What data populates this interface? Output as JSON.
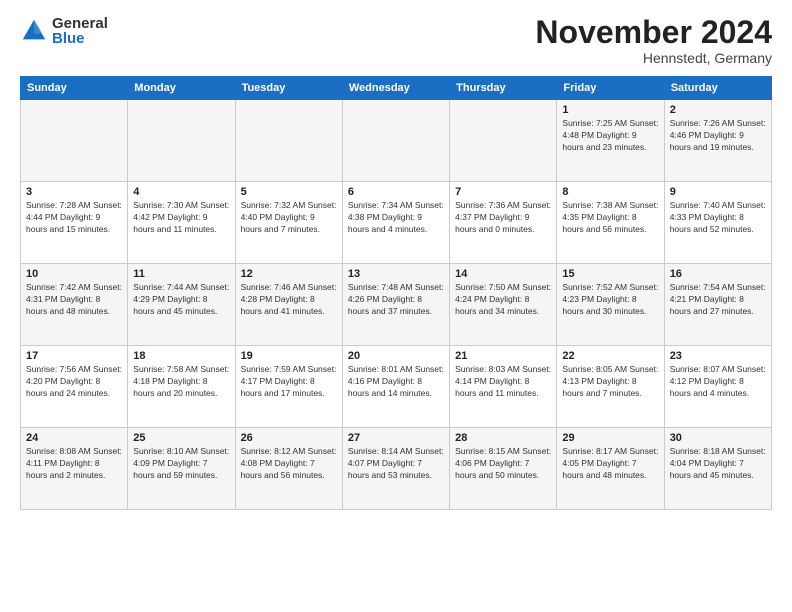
{
  "header": {
    "logo_general": "General",
    "logo_blue": "Blue",
    "month_title": "November 2024",
    "location": "Hennstedt, Germany"
  },
  "weekdays": [
    "Sunday",
    "Monday",
    "Tuesday",
    "Wednesday",
    "Thursday",
    "Friday",
    "Saturday"
  ],
  "weeks": [
    [
      {
        "day": "",
        "info": ""
      },
      {
        "day": "",
        "info": ""
      },
      {
        "day": "",
        "info": ""
      },
      {
        "day": "",
        "info": ""
      },
      {
        "day": "",
        "info": ""
      },
      {
        "day": "1",
        "info": "Sunrise: 7:25 AM\nSunset: 4:48 PM\nDaylight: 9 hours\nand 23 minutes."
      },
      {
        "day": "2",
        "info": "Sunrise: 7:26 AM\nSunset: 4:46 PM\nDaylight: 9 hours\nand 19 minutes."
      }
    ],
    [
      {
        "day": "3",
        "info": "Sunrise: 7:28 AM\nSunset: 4:44 PM\nDaylight: 9 hours\nand 15 minutes."
      },
      {
        "day": "4",
        "info": "Sunrise: 7:30 AM\nSunset: 4:42 PM\nDaylight: 9 hours\nand 11 minutes."
      },
      {
        "day": "5",
        "info": "Sunrise: 7:32 AM\nSunset: 4:40 PM\nDaylight: 9 hours\nand 7 minutes."
      },
      {
        "day": "6",
        "info": "Sunrise: 7:34 AM\nSunset: 4:38 PM\nDaylight: 9 hours\nand 4 minutes."
      },
      {
        "day": "7",
        "info": "Sunrise: 7:36 AM\nSunset: 4:37 PM\nDaylight: 9 hours\nand 0 minutes."
      },
      {
        "day": "8",
        "info": "Sunrise: 7:38 AM\nSunset: 4:35 PM\nDaylight: 8 hours\nand 56 minutes."
      },
      {
        "day": "9",
        "info": "Sunrise: 7:40 AM\nSunset: 4:33 PM\nDaylight: 8 hours\nand 52 minutes."
      }
    ],
    [
      {
        "day": "10",
        "info": "Sunrise: 7:42 AM\nSunset: 4:31 PM\nDaylight: 8 hours\nand 48 minutes."
      },
      {
        "day": "11",
        "info": "Sunrise: 7:44 AM\nSunset: 4:29 PM\nDaylight: 8 hours\nand 45 minutes."
      },
      {
        "day": "12",
        "info": "Sunrise: 7:46 AM\nSunset: 4:28 PM\nDaylight: 8 hours\nand 41 minutes."
      },
      {
        "day": "13",
        "info": "Sunrise: 7:48 AM\nSunset: 4:26 PM\nDaylight: 8 hours\nand 37 minutes."
      },
      {
        "day": "14",
        "info": "Sunrise: 7:50 AM\nSunset: 4:24 PM\nDaylight: 8 hours\nand 34 minutes."
      },
      {
        "day": "15",
        "info": "Sunrise: 7:52 AM\nSunset: 4:23 PM\nDaylight: 8 hours\nand 30 minutes."
      },
      {
        "day": "16",
        "info": "Sunrise: 7:54 AM\nSunset: 4:21 PM\nDaylight: 8 hours\nand 27 minutes."
      }
    ],
    [
      {
        "day": "17",
        "info": "Sunrise: 7:56 AM\nSunset: 4:20 PM\nDaylight: 8 hours\nand 24 minutes."
      },
      {
        "day": "18",
        "info": "Sunrise: 7:58 AM\nSunset: 4:18 PM\nDaylight: 8 hours\nand 20 minutes."
      },
      {
        "day": "19",
        "info": "Sunrise: 7:59 AM\nSunset: 4:17 PM\nDaylight: 8 hours\nand 17 minutes."
      },
      {
        "day": "20",
        "info": "Sunrise: 8:01 AM\nSunset: 4:16 PM\nDaylight: 8 hours\nand 14 minutes."
      },
      {
        "day": "21",
        "info": "Sunrise: 8:03 AM\nSunset: 4:14 PM\nDaylight: 8 hours\nand 11 minutes."
      },
      {
        "day": "22",
        "info": "Sunrise: 8:05 AM\nSunset: 4:13 PM\nDaylight: 8 hours\nand 7 minutes."
      },
      {
        "day": "23",
        "info": "Sunrise: 8:07 AM\nSunset: 4:12 PM\nDaylight: 8 hours\nand 4 minutes."
      }
    ],
    [
      {
        "day": "24",
        "info": "Sunrise: 8:08 AM\nSunset: 4:11 PM\nDaylight: 8 hours\nand 2 minutes."
      },
      {
        "day": "25",
        "info": "Sunrise: 8:10 AM\nSunset: 4:09 PM\nDaylight: 7 hours\nand 59 minutes."
      },
      {
        "day": "26",
        "info": "Sunrise: 8:12 AM\nSunset: 4:08 PM\nDaylight: 7 hours\nand 56 minutes."
      },
      {
        "day": "27",
        "info": "Sunrise: 8:14 AM\nSunset: 4:07 PM\nDaylight: 7 hours\nand 53 minutes."
      },
      {
        "day": "28",
        "info": "Sunrise: 8:15 AM\nSunset: 4:06 PM\nDaylight: 7 hours\nand 50 minutes."
      },
      {
        "day": "29",
        "info": "Sunrise: 8:17 AM\nSunset: 4:05 PM\nDaylight: 7 hours\nand 48 minutes."
      },
      {
        "day": "30",
        "info": "Sunrise: 8:18 AM\nSunset: 4:04 PM\nDaylight: 7 hours\nand 45 minutes."
      }
    ]
  ]
}
